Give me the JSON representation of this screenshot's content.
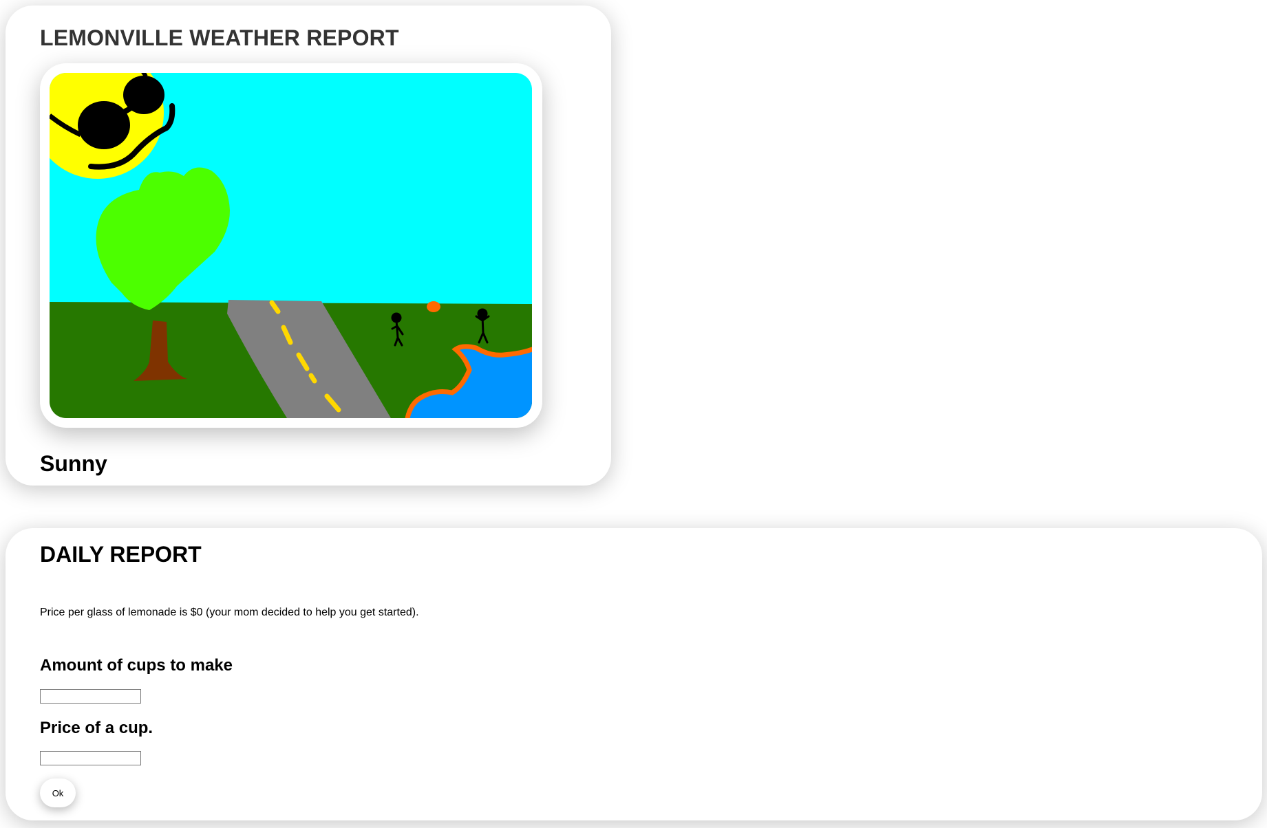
{
  "weather": {
    "title": "LEMONVILLE WEATHER REPORT",
    "condition": "Sunny",
    "illustration": {
      "colors": {
        "sky": "#00ffff",
        "grass": "#267800",
        "sun": "#ffff00",
        "sunglasses": "#000000",
        "tree_leaves": "#4cff00",
        "tree_trunk": "#7f3300",
        "road": "#808080",
        "road_lines": "#ffd800",
        "water": "#0094ff",
        "shore": "#ff6a00",
        "ball": "#ff6a00"
      }
    }
  },
  "daily_report": {
    "title": "DAILY REPORT",
    "info": "Price per glass of lemonade is $0 (your mom decided to help you get started).",
    "cups_label": "Amount of cups to make",
    "cups_value": "",
    "price_label": "Price of a cup.",
    "price_value": "",
    "ok_label": "Ok"
  }
}
